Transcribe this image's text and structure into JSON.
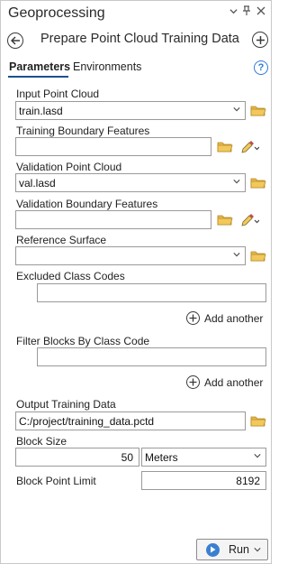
{
  "window": {
    "title": "Geoprocessing",
    "controls": [
      "▾",
      "ᵖ",
      "✕"
    ]
  },
  "tool": {
    "title": "Prepare Point Cloud Training Data"
  },
  "tabs": [
    {
      "label": "Parameters",
      "active": true
    },
    {
      "label": "Environments",
      "active": false
    }
  ],
  "help_label": "?",
  "params": {
    "input_point_cloud": {
      "label": "Input Point Cloud",
      "value": "train.lasd"
    },
    "training_boundary": {
      "label": "Training Boundary Features",
      "value": ""
    },
    "validation_point_cloud": {
      "label": "Validation Point Cloud",
      "value": "val.lasd"
    },
    "validation_boundary": {
      "label": "Validation Boundary Features",
      "value": ""
    },
    "reference_surface": {
      "label": "Reference Surface",
      "value": ""
    },
    "excluded_class_codes": {
      "label": "Excluded Class Codes",
      "value": "",
      "add_label": "Add another"
    },
    "filter_blocks": {
      "label": "Filter Blocks By Class Code",
      "value": "",
      "add_label": "Add another"
    },
    "output_training_data": {
      "label": "Output Training Data",
      "value": "C:/project/training_data.pctd"
    },
    "block_size": {
      "label": "Block Size",
      "value": "50",
      "unit": "Meters"
    },
    "block_point_limit": {
      "label": "Block Point Limit",
      "value": "8192"
    }
  },
  "run": {
    "label": "Run"
  },
  "colors": {
    "accent": "#1a4f8f",
    "help": "#2f7ad6",
    "folder": "#e8b64a",
    "run_icon": "#3b7fd0"
  }
}
